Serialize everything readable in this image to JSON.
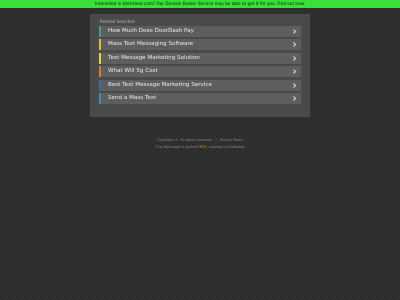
{
  "banner": {
    "text": "Interested in bterrtood.com? Our Domain Broker Service may be able to get it for you. Find out how."
  },
  "colors": {
    "banner_bg": "#38e038",
    "page_bg": "#2c2c2c",
    "panel_bg": "#4a4a4a",
    "item_bg": "#5e5e5e"
  },
  "related": {
    "heading": "Related Searches",
    "items": [
      {
        "label": "How Much Does DoorDash Pay",
        "accent": "#2aa59a",
        "icon": "chevron-right-icon"
      },
      {
        "label": "Mass Text Messaging Software",
        "accent": "#d8c23a",
        "icon": "chevron-right-icon"
      },
      {
        "label": "Text Message Marketing Solution",
        "accent": "#e8d24a",
        "icon": "chevron-right-icon"
      },
      {
        "label": "What Will 5g Cost",
        "accent": "#e07a2a",
        "icon": "chevron-right-icon"
      },
      {
        "label": "Best Text Message Marketing Service",
        "accent": "#3a6ea5",
        "icon": "chevron-right-icon"
      },
      {
        "label": "Send a Mass Text",
        "accent": "#2a9ab0",
        "icon": "chevron-right-icon"
      }
    ]
  },
  "footer": {
    "copyright": "Copyright ©. All rights reserved.",
    "privacy": "Privacy Policy",
    "parked_prefix": "This Web page is parked",
    "parked_highlight": "FREE",
    "parked_suffix": ", courtesy of GoDaddy"
  }
}
